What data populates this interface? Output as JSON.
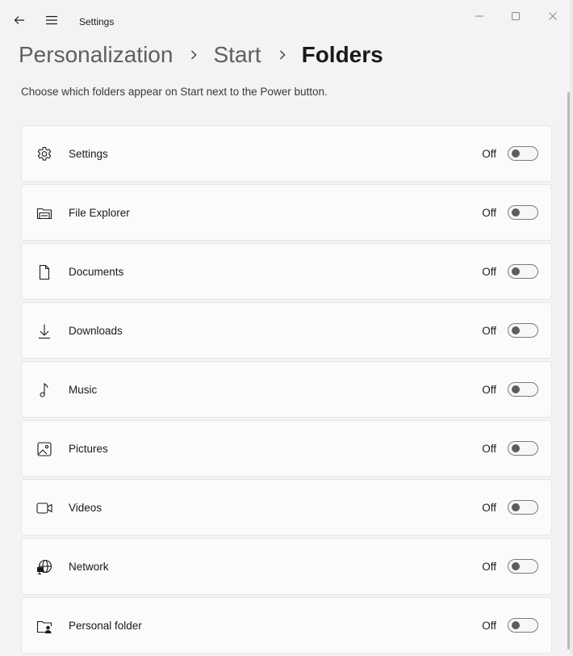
{
  "window": {
    "app_title": "Settings",
    "back_icon": "back-arrow-icon",
    "menu_icon": "hamburger-menu-icon",
    "controls": [
      "minimize-icon",
      "maximize-icon",
      "close-icon"
    ]
  },
  "breadcrumb": {
    "items": [
      "Personalization",
      "Start",
      "Folders"
    ],
    "separator_icon": "chevron-right-icon"
  },
  "description": "Choose which folders appear on Start next to the Power button.",
  "folders": [
    {
      "label": "Settings",
      "state": "Off",
      "icon": "gear-icon",
      "on": false
    },
    {
      "label": "File Explorer",
      "state": "Off",
      "icon": "folder-icon",
      "on": false
    },
    {
      "label": "Documents",
      "state": "Off",
      "icon": "document-icon",
      "on": false
    },
    {
      "label": "Downloads",
      "state": "Off",
      "icon": "download-icon",
      "on": false
    },
    {
      "label": "Music",
      "state": "Off",
      "icon": "music-note-icon",
      "on": false
    },
    {
      "label": "Pictures",
      "state": "Off",
      "icon": "picture-icon",
      "on": false
    },
    {
      "label": "Videos",
      "state": "Off",
      "icon": "video-camera-icon",
      "on": false
    },
    {
      "label": "Network",
      "state": "Off",
      "icon": "network-globe-icon",
      "on": false
    },
    {
      "label": "Personal folder",
      "state": "Off",
      "icon": "personal-folder-icon",
      "on": false
    }
  ],
  "colors": {
    "background": "#f3f3f3",
    "card": "#fbfbfb",
    "card_border": "#e6e6e6",
    "toggle_off_knob": "#5d5d5d"
  }
}
